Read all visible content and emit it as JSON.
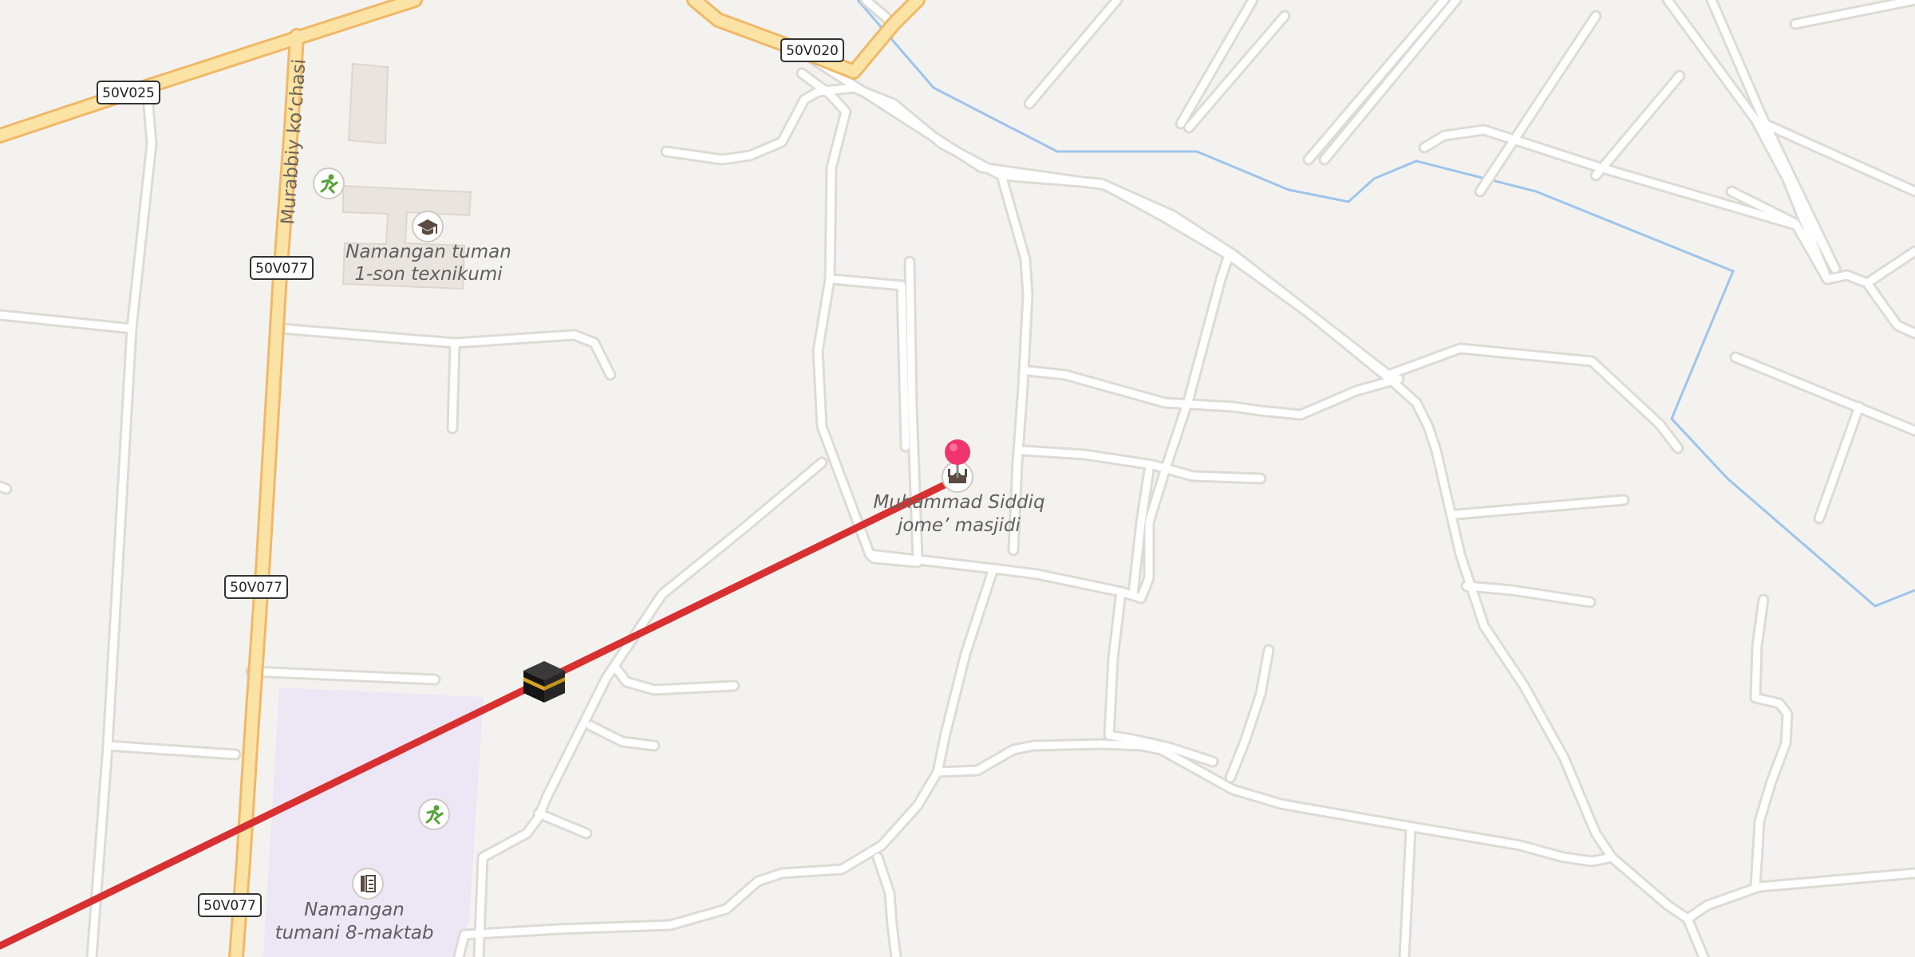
{
  "map": {
    "road_shields": [
      "50V025",
      "50V020",
      "50V077",
      "50V077",
      "50V077"
    ],
    "street_name": "Murabbiy ko‘chasi",
    "pois": [
      {
        "name_line1": "Namangan tuman",
        "name_line2": "1-son texnikumi",
        "icon": "graduation-cap-icon"
      },
      {
        "name_line1": "Muhammad Siddiq",
        "name_line2": "jome’ masjidi",
        "icon": "mosque-icon"
      },
      {
        "name_line1": "Namangan",
        "name_line2": "tumani 8-maktab",
        "icon": "school-icon"
      }
    ],
    "other_icons": [
      "sports-pitch-icon",
      "kaaba-icon",
      "location-pin-icon"
    ],
    "colors": {
      "background": "#f4f2ef",
      "major_road": "#fbe3a5",
      "major_road_casing": "#f0b867",
      "minor_road": "#ffffff",
      "minor_road_casing": "#dedad4",
      "water": "#9cc5ec",
      "qibla_line": "#d83030",
      "school_area": "#ede6f5",
      "pin": "#f0356e"
    }
  }
}
